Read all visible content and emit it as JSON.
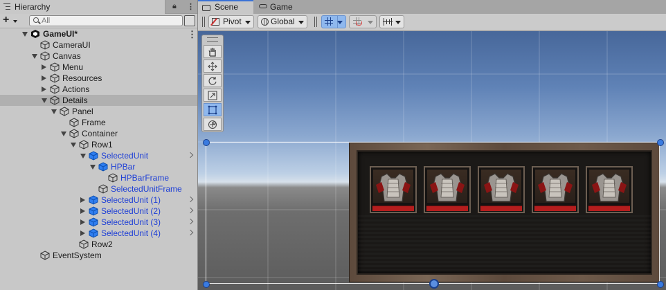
{
  "hierarchy": {
    "tab_title": "Hierarchy",
    "search_placeholder": "All",
    "tree": [
      {
        "label": "GameUI*",
        "depth": 0,
        "arrow": "down",
        "icon": "unity-logo-icon",
        "bold": true,
        "kebab": true
      },
      {
        "label": "CameraUI",
        "depth": 1,
        "arrow": "",
        "icon": "gameobject-cube-icon"
      },
      {
        "label": "Canvas",
        "depth": 1,
        "arrow": "down",
        "icon": "gameobject-cube-icon"
      },
      {
        "label": "Menu",
        "depth": 2,
        "arrow": "right",
        "icon": "gameobject-cube-icon"
      },
      {
        "label": "Resources",
        "depth": 2,
        "arrow": "right",
        "icon": "gameobject-cube-icon"
      },
      {
        "label": "Actions",
        "depth": 2,
        "arrow": "right",
        "icon": "gameobject-cube-icon"
      },
      {
        "label": "Details",
        "depth": 2,
        "arrow": "down",
        "icon": "gameobject-cube-icon",
        "selected": true
      },
      {
        "label": "Panel",
        "depth": 3,
        "arrow": "down",
        "icon": "gameobject-cube-icon"
      },
      {
        "label": "Frame",
        "depth": 4,
        "arrow": "",
        "icon": "gameobject-cube-icon"
      },
      {
        "label": "Container",
        "depth": 4,
        "arrow": "down",
        "icon": "gameobject-cube-icon"
      },
      {
        "label": "Row1",
        "depth": 5,
        "arrow": "down",
        "icon": "gameobject-cube-icon"
      },
      {
        "label": "SelectedUnit",
        "depth": 6,
        "arrow": "down",
        "icon": "prefab-cube-icon",
        "blue": true,
        "chevron": true
      },
      {
        "label": "HPBar",
        "depth": 7,
        "arrow": "down",
        "icon": "prefab-cube-icon",
        "blue": true
      },
      {
        "label": "HPBarFrame",
        "depth": 8,
        "arrow": "",
        "icon": "gameobject-cube-icon",
        "blue": true
      },
      {
        "label": "SelectedUnitFrame",
        "depth": 7,
        "arrow": "",
        "icon": "gameobject-cube-icon",
        "blue": true
      },
      {
        "label": "SelectedUnit (1)",
        "depth": 6,
        "arrow": "right",
        "icon": "prefab-cube-icon",
        "blue": true,
        "chevron": true
      },
      {
        "label": "SelectedUnit (2)",
        "depth": 6,
        "arrow": "right",
        "icon": "prefab-cube-icon",
        "blue": true,
        "chevron": true
      },
      {
        "label": "SelectedUnit (3)",
        "depth": 6,
        "arrow": "right",
        "icon": "prefab-cube-icon",
        "blue": true,
        "chevron": true
      },
      {
        "label": "SelectedUnit (4)",
        "depth": 6,
        "arrow": "right",
        "icon": "prefab-cube-icon",
        "blue": true,
        "chevron": true
      },
      {
        "label": "Row2",
        "depth": 5,
        "arrow": "",
        "icon": "gameobject-cube-icon"
      },
      {
        "label": "EventSystem",
        "depth": 1,
        "arrow": "",
        "icon": "gameobject-cube-icon"
      }
    ]
  },
  "scene": {
    "tabs": [
      {
        "label": "Scene",
        "active": true
      },
      {
        "label": "Game",
        "active": false
      }
    ],
    "toolbar": {
      "pivot_label": "Pivot",
      "global_label": "Global"
    },
    "tools": [
      "hand-tool-icon",
      "move-tool-icon",
      "rotate-tool-icon",
      "scale-tool-icon",
      "rect-tool-icon",
      "transform-tool-icon"
    ],
    "active_tool": "rect-tool-icon",
    "unit_slots": 5
  },
  "colors": {
    "accent": "#3a72d6",
    "prefab_text": "#1e3fd6",
    "selected_row": "#b0b0b0",
    "hp_bar": "#b51d1d",
    "panel_frame": "#6a5545"
  }
}
